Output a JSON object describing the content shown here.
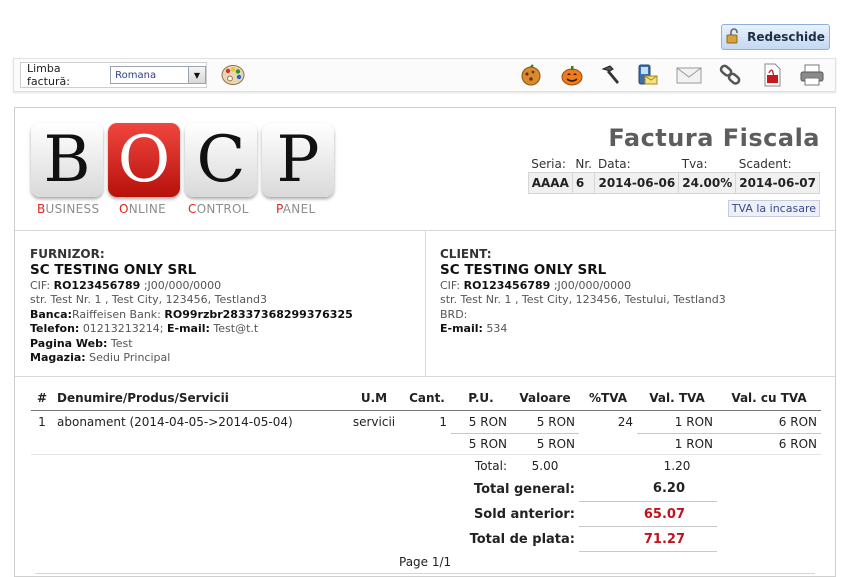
{
  "reopen_button": {
    "label": "Redeschide",
    "icon": "lock-open-icon"
  },
  "toolbar": {
    "language_label": "Limba factură:",
    "language_value": "Romana",
    "icons": [
      "palette-icon",
      "cookie-icon",
      "pumpkin-icon",
      "hammer-icon",
      "phone-email-icon",
      "envelope-icon",
      "link-icon",
      "pdf-icon",
      "printer-icon"
    ]
  },
  "invoice": {
    "title": "Factura Fiscala",
    "logo": {
      "letters": [
        "B",
        "O",
        "C",
        "P"
      ],
      "words": [
        [
          "B",
          "USINESS"
        ],
        [
          "O",
          "NLINE"
        ],
        [
          "C",
          "ONTROL"
        ],
        [
          "P",
          "ANEL"
        ]
      ]
    },
    "meta": {
      "headers": [
        "Seria:",
        "Nr.",
        "Data:",
        "Tva:",
        "Scadent:"
      ],
      "values": [
        "AAAA",
        "6",
        "2014-06-06",
        "24.00%",
        "2014-06-07"
      ]
    },
    "vat_badge": "TVA la incasare",
    "supplier": {
      "label": "FURNIZOR:",
      "name": "SC TESTING ONLY SRL",
      "cif_label": "CIF:",
      "cif": "RO123456789",
      "reg": ";J00/000/0000",
      "address": "str. Test Nr. 1 , Test City, 123456, Testland3",
      "bank_label": "Banca:",
      "bank": "Raiffeisen Bank:",
      "iban": "RO99rzbr28337368299376325",
      "phone_label": "Telefon:",
      "phone": "01213213214;",
      "email_label": "E-mail:",
      "email": "Test@t.t",
      "web_label": "Pagina Web:",
      "web": "Test",
      "store_label": "Magazia:",
      "store": "Sediu Principal"
    },
    "client": {
      "label": "CLIENT:",
      "name": "SC TESTING ONLY SRL",
      "cif_label": "CIF:",
      "cif": "RO123456789",
      "reg": ";J00/000/0000",
      "address": "str. Test Nr. 1 , Test City, 123456, Testului, Testland3",
      "brd": "BRD:",
      "email_label": "E-mail:",
      "email": "534"
    },
    "table": {
      "headers": [
        "#",
        "Denumire/Produs/Servicii",
        "U.M",
        "Cant.",
        "P.U.",
        "Valoare",
        "%TVA",
        "Val. TVA",
        "Val. cu TVA"
      ],
      "rows": [
        {
          "nr": "1",
          "name": "abonament (2014-04-05->2014-05-04)",
          "um": "servicii",
          "qty": "1",
          "pu": "5 RON",
          "value": "5 RON",
          "vat_pct": "24",
          "vat_val": "1 RON",
          "with_vat": "6 RON"
        }
      ],
      "subtotal": {
        "pu": "5 RON",
        "value": "5 RON",
        "vat_val": "1 RON",
        "with_vat": "6 RON"
      },
      "total_label": "Total:",
      "total_value": "5.00",
      "total_vat": "1.20"
    },
    "summary": [
      {
        "label": "Total general:",
        "value": "6.20",
        "color": "#111111"
      },
      {
        "label": "Sold anterior:",
        "value": "65.07",
        "color": "#c1121f"
      },
      {
        "label": "Total de plata:",
        "value": "71.27",
        "color": "#c1121f"
      }
    ],
    "page": "Page 1/1"
  }
}
